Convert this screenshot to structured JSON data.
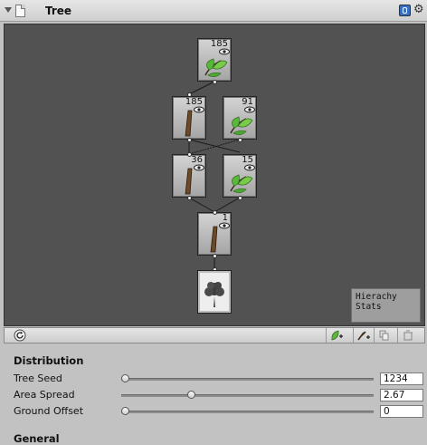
{
  "header": {
    "title": "Tree",
    "fold_icon": "triangle-down-icon",
    "help_icon": "help-book-icon",
    "settings_icon": "gear-icon"
  },
  "graph": {
    "nodes": [
      {
        "id": "leaf-top",
        "kind": "leaf",
        "count": "185"
      },
      {
        "id": "branch-mid-left",
        "kind": "branch",
        "count": "185"
      },
      {
        "id": "leaf-mid-right",
        "kind": "leaf",
        "count": "91"
      },
      {
        "id": "branch-low-left",
        "kind": "branch",
        "count": "36"
      },
      {
        "id": "leaf-low-right",
        "kind": "leaf",
        "count": "15"
      },
      {
        "id": "trunk",
        "kind": "branch",
        "count": "1"
      },
      {
        "id": "root",
        "kind": "tree-root",
        "count": ""
      }
    ],
    "stats_panel": {
      "line1": "Hierachy",
      "line2": "Stats"
    }
  },
  "toolbar": {
    "refresh_icon": "refresh-icon",
    "buttons": [
      "add-leaf-group-icon",
      "add-branch-group-icon",
      "duplicate-icon",
      "delete-icon"
    ]
  },
  "distribution": {
    "title": "Distribution",
    "rows": [
      {
        "label": "Tree Seed",
        "value": "1234",
        "slider": 0.0
      },
      {
        "label": "Area Spread",
        "value": "2.67",
        "slider": 0.27
      },
      {
        "label": "Ground Offset",
        "value": "0",
        "slider": 0.0
      }
    ]
  },
  "next_section": {
    "title": "General"
  }
}
